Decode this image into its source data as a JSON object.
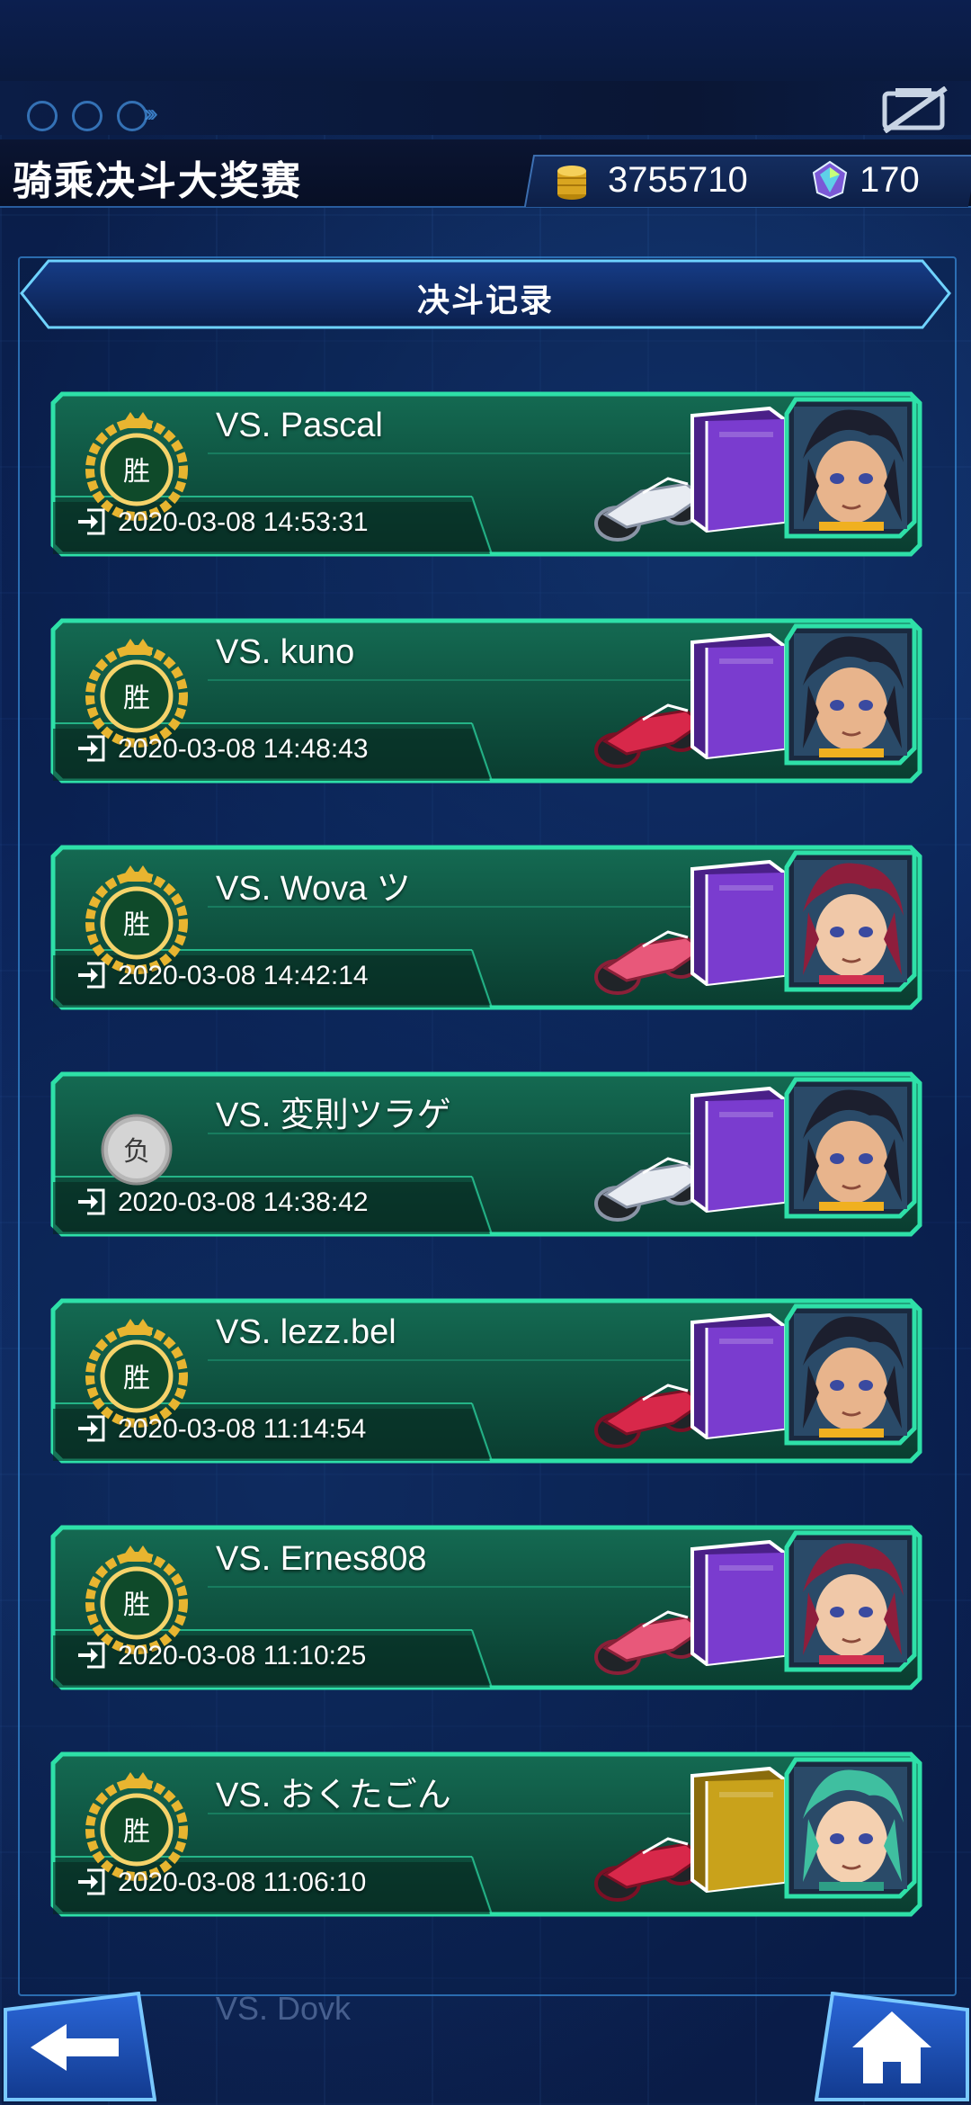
{
  "header": {
    "title": "骑乘决斗大奖赛",
    "coins": "3755710",
    "gems": "170"
  },
  "section": {
    "title": "决斗记录"
  },
  "duels": [
    {
      "result": "win",
      "badge": "胜",
      "opponent": "VS. Pascal",
      "date": "2020-03-08 14:53:31",
      "bike": "white",
      "deck": "purple",
      "avatar": "yusei"
    },
    {
      "result": "win",
      "badge": "胜",
      "opponent": "VS. kuno",
      "date": "2020-03-08 14:48:43",
      "bike": "red",
      "deck": "purple",
      "avatar": "yusei"
    },
    {
      "result": "win",
      "badge": "胜",
      "opponent": "VS. Wova ツ",
      "date": "2020-03-08 14:42:14",
      "bike": "pink",
      "deck": "purple",
      "avatar": "aki"
    },
    {
      "result": "loss",
      "badge": "负",
      "opponent": "VS. 変則ツラゲ",
      "date": "2020-03-08 14:38:42",
      "bike": "white",
      "deck": "purple",
      "avatar": "yusei"
    },
    {
      "result": "win",
      "badge": "胜",
      "opponent": "VS. lezz.bel",
      "date": "2020-03-08 11:14:54",
      "bike": "red",
      "deck": "purple",
      "avatar": "yusei"
    },
    {
      "result": "win",
      "badge": "胜",
      "opponent": "VS. Ernes808",
      "date": "2020-03-08 11:10:25",
      "bike": "pink",
      "deck": "purple",
      "avatar": "aki"
    },
    {
      "result": "win",
      "badge": "胜",
      "opponent": "VS. おくたごん",
      "date": "2020-03-08 11:06:10",
      "bike": "red",
      "deck": "gold",
      "avatar": "luka"
    }
  ],
  "footer": {
    "ghost_text": "VS. Dovk"
  },
  "colors": {
    "card_green": "#0f5a47",
    "card_border": "#2ee0a8",
    "deck_purple": "#7a3ccf",
    "deck_gold": "#c9a21b",
    "win_gold": "#e8b530",
    "loss_gray": "#b7b7b7"
  },
  "icons": {
    "coin": "coin-stack-icon",
    "gem": "gem-icon",
    "back": "back-arrow-icon",
    "home": "home-icon",
    "date": "login-arrow-icon",
    "toggle": "hide-display-icon"
  }
}
